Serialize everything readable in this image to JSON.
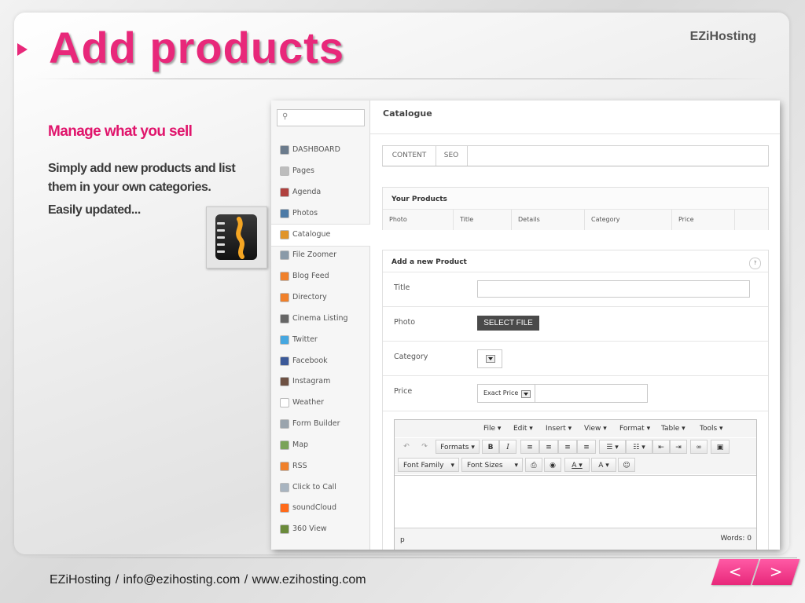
{
  "slide": {
    "title": "Add products",
    "brand": "EZiHosting",
    "subtitle": "Manage what you sell",
    "body_lines": [
      "Simply add new products and list them in your own categories.",
      "Easily updated..."
    ]
  },
  "shot": {
    "search_icon": "search-icon",
    "sidebar": [
      {
        "label": "DASHBOARD",
        "icon": "dashboard-icon",
        "color": "#6b7b8c"
      },
      {
        "label": "Pages",
        "icon": "pages-icon",
        "color": "#bdbdbd"
      },
      {
        "label": "Agenda",
        "icon": "agenda-icon",
        "color": "#b0413e"
      },
      {
        "label": "Photos",
        "icon": "photos-icon",
        "color": "#4c7aa6"
      },
      {
        "label": "Catalogue",
        "icon": "catalogue-icon",
        "color": "#e0942a"
      },
      {
        "label": "File Zoomer",
        "icon": "file-zoomer-icon",
        "color": "#8a9aa8"
      },
      {
        "label": "Blog Feed",
        "icon": "rss-icon",
        "color": "#f0802a"
      },
      {
        "label": "Directory",
        "icon": "rss-icon",
        "color": "#f0802a"
      },
      {
        "label": "Cinema Listing",
        "icon": "cinema-icon",
        "color": "#666666"
      },
      {
        "label": "Twitter",
        "icon": "twitter-icon",
        "color": "#46a7e0"
      },
      {
        "label": "Facebook",
        "icon": "facebook-icon",
        "color": "#3b5998"
      },
      {
        "label": "Instagram",
        "icon": "instagram-icon",
        "color": "#6e5143"
      },
      {
        "label": "Weather",
        "icon": "weather-icon",
        "color": "#ffffff"
      },
      {
        "label": "Form Builder",
        "icon": "form-builder-icon",
        "color": "#9aa4ad"
      },
      {
        "label": "Map",
        "icon": "map-icon",
        "color": "#7aa35a"
      },
      {
        "label": "RSS",
        "icon": "rss-icon",
        "color": "#f0802a"
      },
      {
        "label": "Click to Call",
        "icon": "phone-icon",
        "color": "#a8b4c0"
      },
      {
        "label": "soundCloud",
        "icon": "soundcloud-icon",
        "color": "#ff6a1a"
      },
      {
        "label": "360 View",
        "icon": "360-view-icon",
        "color": "#6a8a3a"
      }
    ],
    "active_item": "Catalogue",
    "page_title": "Catalogue",
    "tabs": [
      "CONTENT",
      "SEO"
    ],
    "products": {
      "heading": "Your Products",
      "columns": [
        "Photo",
        "Title",
        "Details",
        "Category",
        "Price"
      ]
    },
    "form": {
      "heading": "Add a new Product",
      "help": "?",
      "title_label": "Title",
      "title_value": "",
      "photo_label": "Photo",
      "select_file": "SELECT FILE",
      "category_label": "Category",
      "price_label": "Price",
      "price_type": "Exact Price",
      "price_value": ""
    },
    "editor": {
      "menus": [
        "File ▾",
        "Edit ▾",
        "Insert ▾",
        "View ▾",
        "Format ▾",
        "Table ▾",
        "Tools ▾"
      ],
      "formats": "Formats ▾",
      "bold": "B",
      "italic": "I",
      "font_family": "Font Family",
      "font_sizes": "Font Sizes",
      "path": "p",
      "words": "Words: 0"
    }
  },
  "footer": {
    "text": "EZiHosting  /   info@ezihosting.com  /  www.ezihosting.com",
    "prev": "<",
    "next": ">"
  },
  "colors": {
    "accent": "#e8287a"
  }
}
